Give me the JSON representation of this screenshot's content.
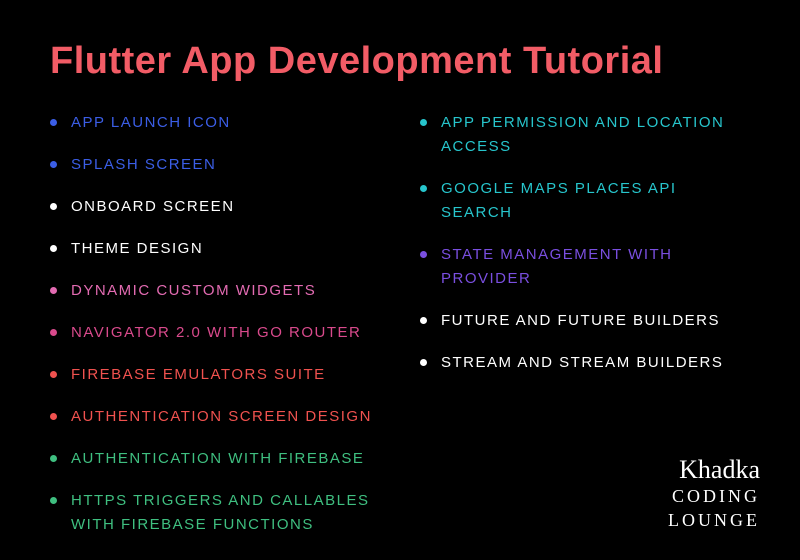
{
  "title": "Flutter App Development Tutorial",
  "colors": {
    "title": "#f25c66",
    "blue": "#3b5ee6",
    "white": "#ffffff",
    "pink": "#e36bb2",
    "magenta": "#d94a8c",
    "redorange": "#f0524f",
    "green": "#3fbf80",
    "teal": "#27c5cc",
    "purple": "#7a4fe0"
  },
  "left": [
    {
      "text": "App Launch Icon",
      "color": "blue"
    },
    {
      "text": "Splash Screen",
      "color": "blue"
    },
    {
      "text": "OnBoard Screen",
      "color": "white"
    },
    {
      "text": "Theme Design",
      "color": "white"
    },
    {
      "text": "Dynamic Custom Widgets",
      "color": "pink"
    },
    {
      "text": "Navigator 2.0 with Go Router",
      "color": "magenta"
    },
    {
      "text": "Firebase Emulators Suite",
      "color": "redorange"
    },
    {
      "text": "Authentication Screen Design",
      "color": "redorange"
    },
    {
      "text": "Authentication with Firebase",
      "color": "green"
    },
    {
      "text": "HTTPS Triggers and Callables with Firebase Functions",
      "color": "green"
    }
  ],
  "right": [
    {
      "text": "App Permission and Location access",
      "color": "teal"
    },
    {
      "text": "Google Maps Places API Search",
      "color": "teal"
    },
    {
      "text": "State Management with Provider",
      "color": "purple"
    },
    {
      "text": "Future and Future Builders",
      "color": "white"
    },
    {
      "text": "Stream and Stream Builders",
      "color": "white"
    }
  ],
  "footer": {
    "script": "Khadka",
    "line1": "CODING",
    "line2": "LOUNGE"
  }
}
